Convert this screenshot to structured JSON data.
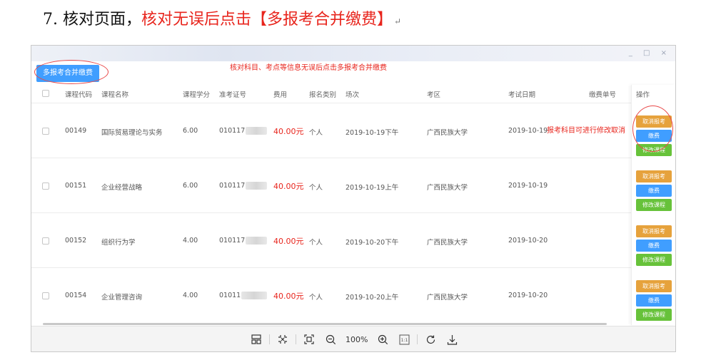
{
  "instruction": {
    "prefix": "7. 核对页面，",
    "highlight": "核对无误后点击【多报考合并缴费】",
    "return_mark": "↵"
  },
  "toolbar_top": {
    "merge_button": "多报考合并缴费",
    "note": "核对科目、考点等信息无误后点击多报考合并缴费"
  },
  "table": {
    "headers": {
      "code": "课程代码",
      "name": "课程名称",
      "credit": "课程学分",
      "ticket": "准考证号",
      "fee": "费用",
      "type": "报名类别",
      "session": "场次",
      "area": "考区",
      "date": "考试日期",
      "payno": "缴费单号",
      "ops": "操作"
    },
    "rows": [
      {
        "code": "00149",
        "name": "国际贸易理论与实务",
        "credit": "6.00",
        "ticket": "010117",
        "fee": "40.00元",
        "type": "个人",
        "session": "2019-10-19下午",
        "area": "广西民族大学",
        "date": "2019-10-19"
      },
      {
        "code": "00151",
        "name": "企业经营战略",
        "credit": "6.00",
        "ticket": "010117",
        "fee": "40.00元",
        "type": "个人",
        "session": "2019-10-19上午",
        "area": "广西民族大学",
        "date": "2019-10-19"
      },
      {
        "code": "00152",
        "name": "组织行为学",
        "credit": "4.00",
        "ticket": "010117",
        "fee": "40.00元",
        "type": "个人",
        "session": "2019-10-20下午",
        "area": "广西民族大学",
        "date": "2019-10-20"
      },
      {
        "code": "00154",
        "name": "企业管理咨询",
        "credit": "4.00",
        "ticket": "01011",
        "fee": "40.00元",
        "type": "个人",
        "session": "2019-10-20上午",
        "area": "广西民族大学",
        "date": "2019-10-20"
      }
    ],
    "op_labels": {
      "cancel": "取消报考",
      "pay": "缴费",
      "modify": "修改课程"
    },
    "side_note": "报考科目可进行修改取消"
  },
  "viewer": {
    "zoom": "100%",
    "original_size": "1:1",
    "window_controls": "_ □ ×"
  },
  "colors": {
    "accent_red": "#e8251d",
    "primary": "#409eff",
    "warning": "#e6a23c",
    "success": "#67c23a"
  }
}
